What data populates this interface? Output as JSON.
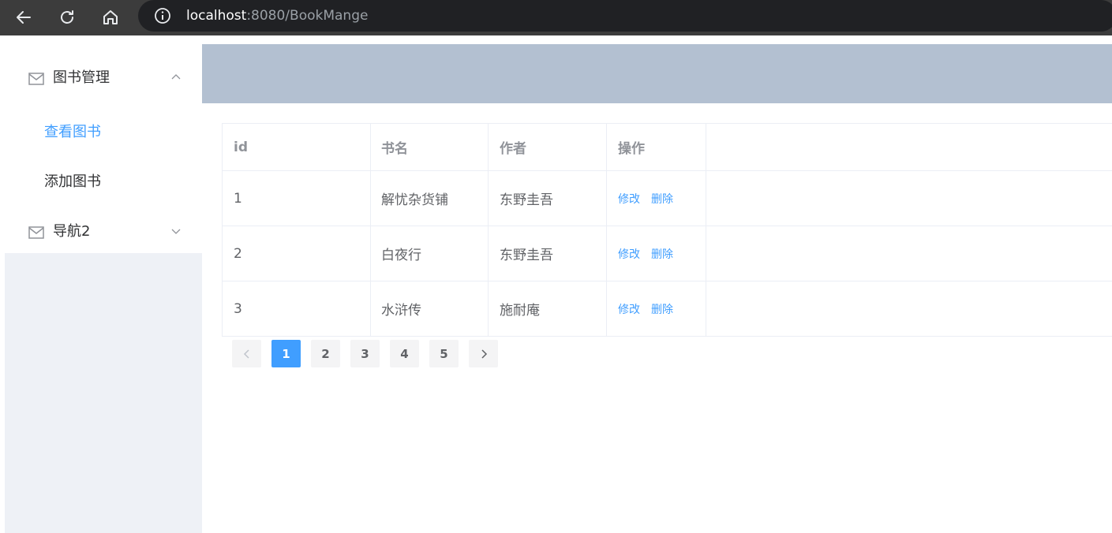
{
  "browser": {
    "url_host": "localhost",
    "url_path": ":8080/BookMange"
  },
  "sidebar": {
    "menus": [
      {
        "title": "图书管理",
        "icon": "mail-icon",
        "expanded": true,
        "items": [
          {
            "label": "查看图书",
            "active": true
          },
          {
            "label": "添加图书",
            "active": false
          }
        ]
      },
      {
        "title": "导航2",
        "icon": "mail-icon",
        "expanded": false,
        "items": []
      }
    ]
  },
  "table": {
    "columns": [
      "id",
      "书名",
      "作者",
      "操作"
    ],
    "rows": [
      {
        "id": "1",
        "name": "解忧杂货铺",
        "author": "东野圭吾"
      },
      {
        "id": "2",
        "name": "白夜行",
        "author": "东野圭吾"
      },
      {
        "id": "3",
        "name": "水浒传",
        "author": "施耐庵"
      }
    ],
    "edit_label": "修改",
    "delete_label": "删除"
  },
  "pagination": {
    "pages": [
      "1",
      "2",
      "3",
      "4",
      "5"
    ],
    "current": "1"
  },
  "colors": {
    "accent": "#409eff",
    "header_bg": "#b3c0d1",
    "sidebar_bg": "#eef1f6"
  }
}
